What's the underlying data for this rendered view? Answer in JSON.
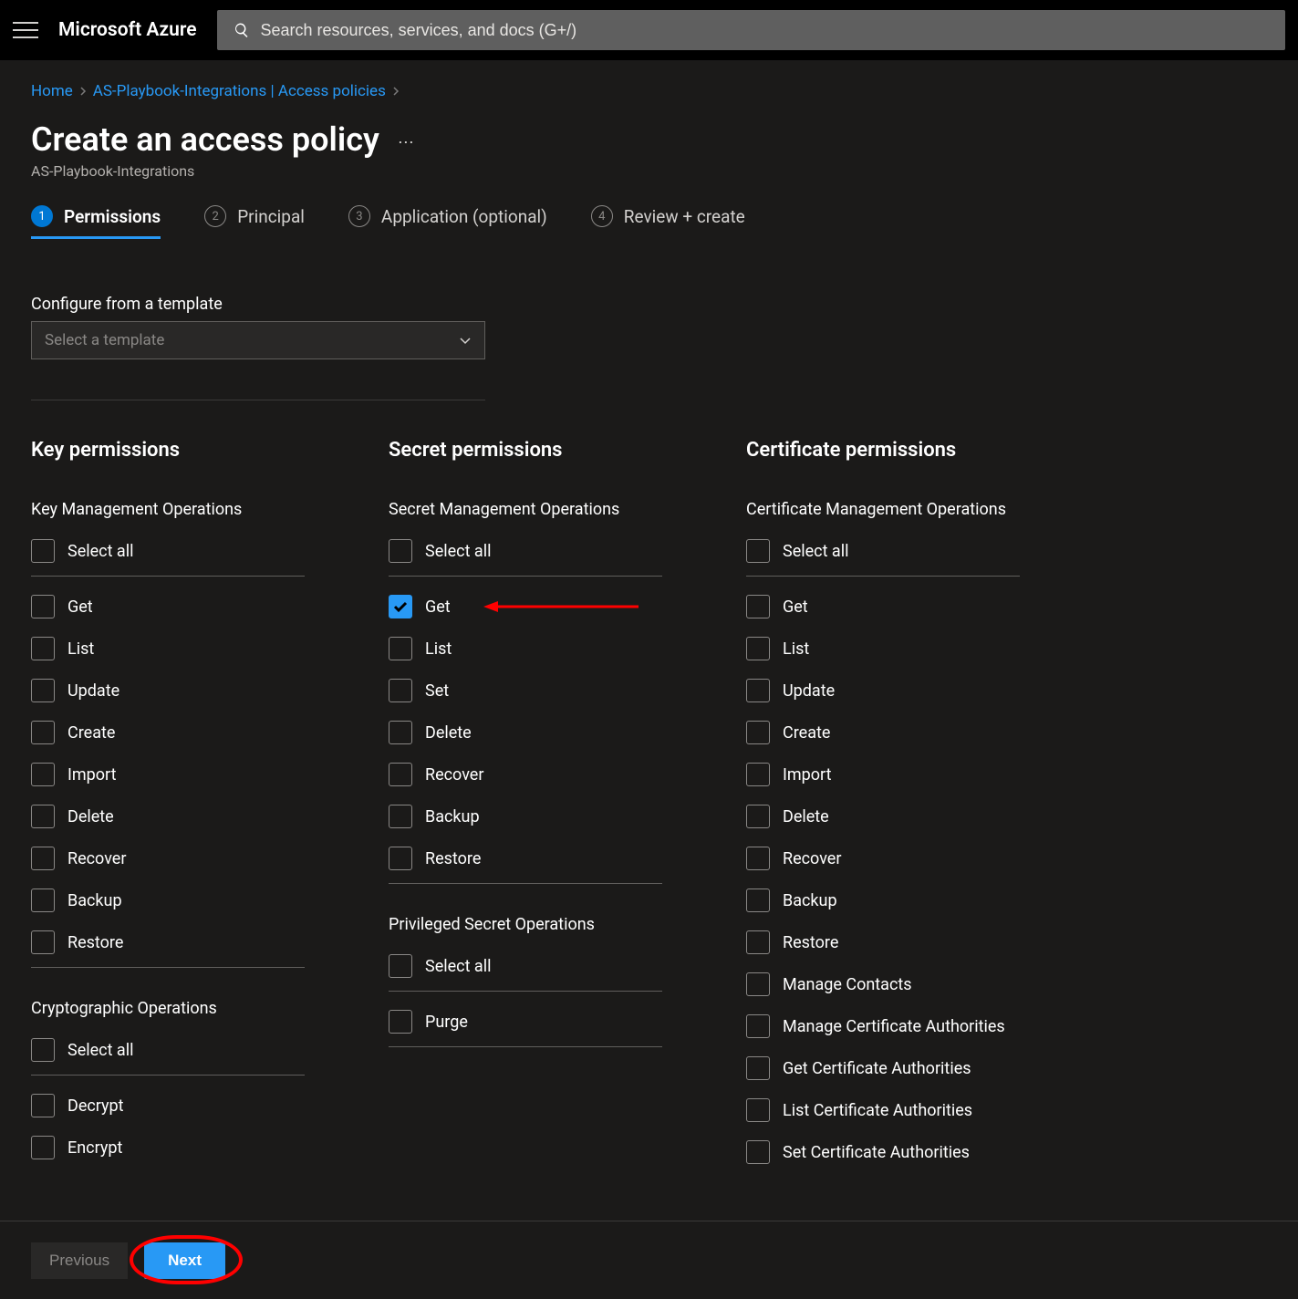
{
  "header": {
    "brand": "Microsoft Azure",
    "search_placeholder": "Search resources, services, and docs (G+/)"
  },
  "breadcrumbs": {
    "items": [
      "Home",
      "AS-Playbook-Integrations | Access policies"
    ]
  },
  "page": {
    "title": "Create an access policy",
    "subtitle": "AS-Playbook-Integrations"
  },
  "tabs": [
    {
      "num": "1",
      "label": "Permissions",
      "active": true
    },
    {
      "num": "2",
      "label": "Principal",
      "active": false
    },
    {
      "num": "3",
      "label": "Application (optional)",
      "active": false
    },
    {
      "num": "4",
      "label": "Review + create",
      "active": false
    }
  ],
  "template": {
    "label": "Configure from a template",
    "placeholder": "Select a template"
  },
  "perm_columns": [
    {
      "heading": "Key permissions",
      "groups": [
        {
          "label": "Key Management Operations",
          "select_all": "Select all",
          "items": [
            {
              "label": "Get",
              "checked": false
            },
            {
              "label": "List",
              "checked": false
            },
            {
              "label": "Update",
              "checked": false
            },
            {
              "label": "Create",
              "checked": false
            },
            {
              "label": "Import",
              "checked": false
            },
            {
              "label": "Delete",
              "checked": false
            },
            {
              "label": "Recover",
              "checked": false
            },
            {
              "label": "Backup",
              "checked": false
            },
            {
              "label": "Restore",
              "checked": false
            }
          ]
        },
        {
          "label": "Cryptographic Operations",
          "select_all": "Select all",
          "items": [
            {
              "label": "Decrypt",
              "checked": false
            },
            {
              "label": "Encrypt",
              "checked": false
            }
          ],
          "no_tail": true
        }
      ]
    },
    {
      "heading": "Secret permissions",
      "groups": [
        {
          "label": "Secret Management Operations",
          "select_all": "Select all",
          "items": [
            {
              "label": "Get",
              "checked": true,
              "arrow": true
            },
            {
              "label": "List",
              "checked": false
            },
            {
              "label": "Set",
              "checked": false
            },
            {
              "label": "Delete",
              "checked": false
            },
            {
              "label": "Recover",
              "checked": false
            },
            {
              "label": "Backup",
              "checked": false
            },
            {
              "label": "Restore",
              "checked": false
            }
          ]
        },
        {
          "label": "Privileged Secret Operations",
          "select_all": "Select all",
          "items": [
            {
              "label": "Purge",
              "checked": false
            }
          ]
        }
      ]
    },
    {
      "heading": "Certificate permissions",
      "groups": [
        {
          "label": "Certificate Management Operations",
          "select_all": "Select all",
          "items": [
            {
              "label": "Get",
              "checked": false
            },
            {
              "label": "List",
              "checked": false
            },
            {
              "label": "Update",
              "checked": false
            },
            {
              "label": "Create",
              "checked": false
            },
            {
              "label": "Import",
              "checked": false
            },
            {
              "label": "Delete",
              "checked": false
            },
            {
              "label": "Recover",
              "checked": false
            },
            {
              "label": "Backup",
              "checked": false
            },
            {
              "label": "Restore",
              "checked": false
            },
            {
              "label": "Manage Contacts",
              "checked": false
            },
            {
              "label": "Manage Certificate Authorities",
              "checked": false
            },
            {
              "label": "Get Certificate Authorities",
              "checked": false
            },
            {
              "label": "List Certificate Authorities",
              "checked": false
            },
            {
              "label": "Set Certificate Authorities",
              "checked": false
            }
          ],
          "no_tail": true
        }
      ]
    }
  ],
  "footer": {
    "prev": "Previous",
    "next": "Next"
  }
}
